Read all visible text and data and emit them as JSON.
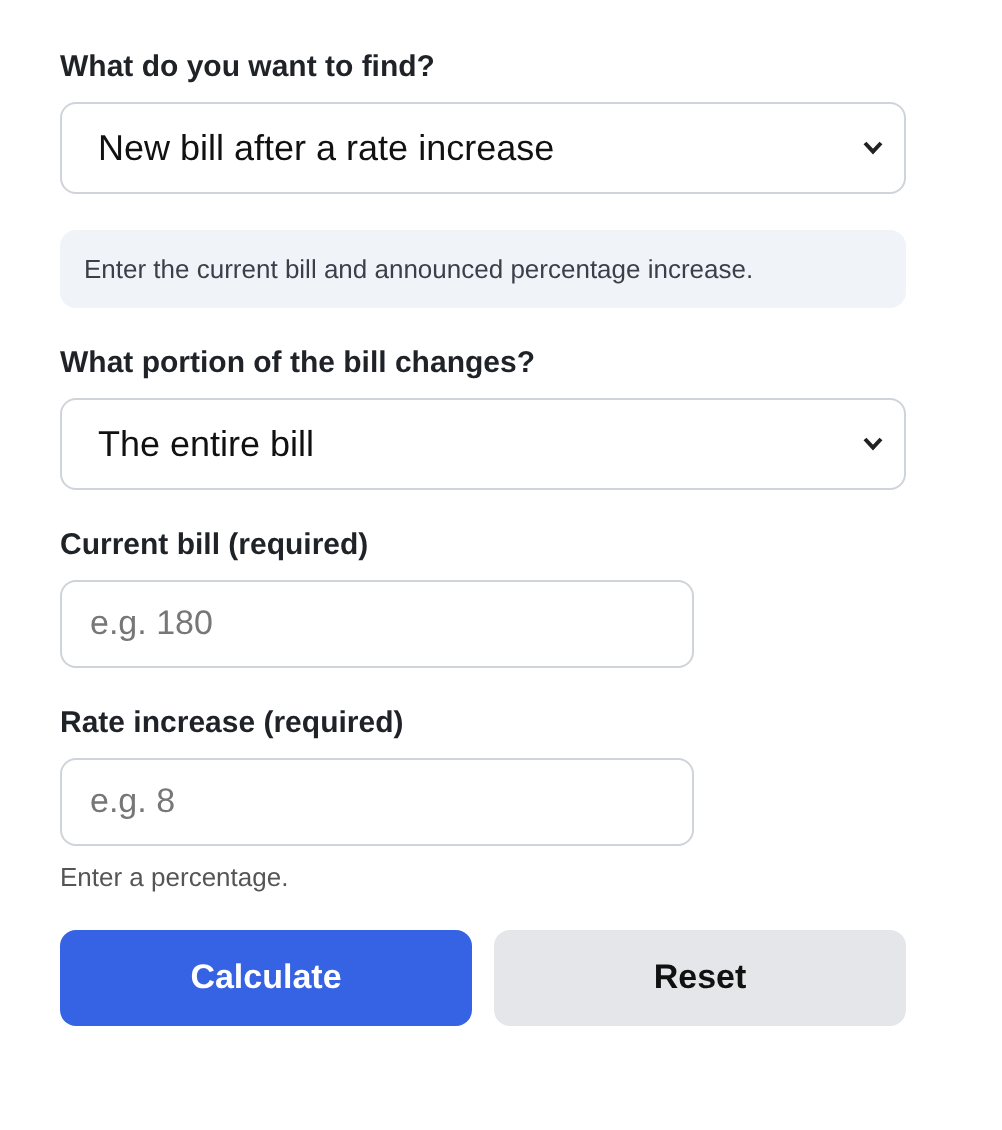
{
  "fields": [
    {
      "kind": "select",
      "label": "What do you want to find?",
      "value": "New bill after a rate increase"
    },
    {
      "kind": "note",
      "text": "Enter the current bill and announced percentage increase."
    },
    {
      "kind": "select",
      "label": "What portion of the bill changes?",
      "value": "The entire bill"
    },
    {
      "kind": "input",
      "label": "Current bill (required)",
      "placeholder": "e.g. 180"
    },
    {
      "kind": "input",
      "label": "Rate increase (required)",
      "placeholder": "e.g. 8",
      "hint": "Enter a percentage."
    }
  ],
  "buttons": [
    {
      "kind": "primary",
      "label": "Calculate"
    },
    {
      "kind": "secondary",
      "label": "Reset"
    }
  ]
}
